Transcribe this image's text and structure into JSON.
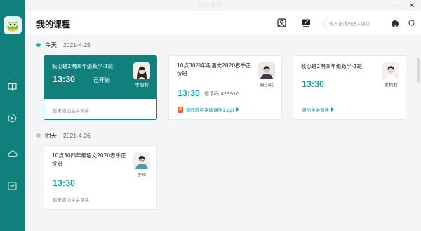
{
  "window": {
    "title": "我的课堂",
    "minimize_label": "—",
    "close_label": "✕"
  },
  "sidebar": {
    "logo_icon": "owl-logo",
    "items": [
      {
        "icon": "book-icon",
        "active": true
      },
      {
        "icon": "playback-icon",
        "active": false
      },
      {
        "icon": "cloud-icon",
        "active": false
      },
      {
        "icon": "chart-icon",
        "active": false
      }
    ]
  },
  "header": {
    "title": "我的课程",
    "search_placeholder": "输入邀请码进入课堂",
    "search_value": ""
  },
  "colors": {
    "brand": "#11807c",
    "accent": "#14a29c",
    "today_dot": "#2bb39b",
    "tomorrow_dot": "#bfbfbf",
    "ppt": "#e8663a"
  },
  "days": [
    {
      "label": "今天",
      "date": "2021-4-25",
      "cards": [
        {
          "title": "收心班2期四年级数学-1班",
          "time": "13:30",
          "status": "已开始",
          "teacher": "李丽莉",
          "note": "暂未添加主讲课件",
          "active": true
        },
        {
          "title": "10点30四年级语文2020春季正价班",
          "time": "13:30",
          "code": "邀请码:423910",
          "teacher": "康小利",
          "link": "课程教学讲解课件1.ppt",
          "active": false
        },
        {
          "title": "收心班2期四年级数学-1班",
          "time": "13:30",
          "teacher": "崔莉莉",
          "link": "添加主讲课件",
          "active": false
        }
      ]
    },
    {
      "label": "明天",
      "date": "2021-4-26",
      "cards": [
        {
          "title": "10点30四年级语文2020春季正价班",
          "time": "13:30",
          "teacher": "李辉",
          "note": "暂未添加主讲课件",
          "active": false
        }
      ]
    }
  ]
}
